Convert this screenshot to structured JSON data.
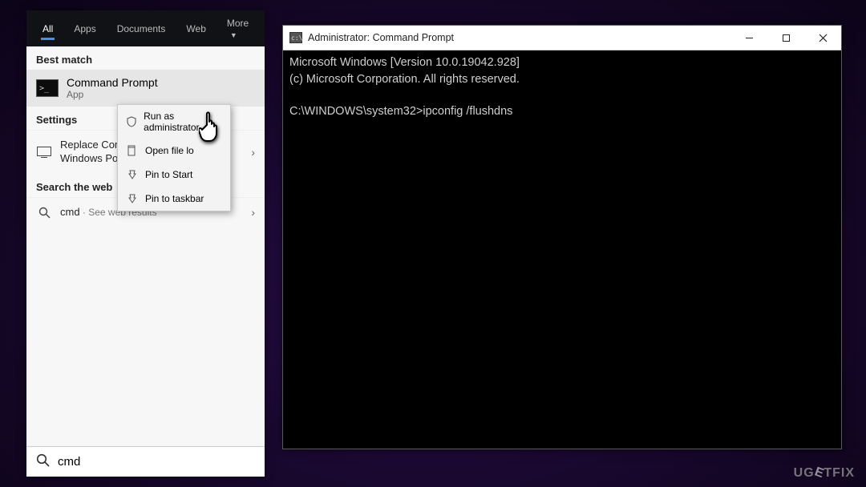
{
  "search": {
    "tabs": {
      "all": "All",
      "apps": "Apps",
      "documents": "Documents",
      "web": "Web",
      "more": "More"
    },
    "sections": {
      "best_match": "Best match",
      "settings": "Settings",
      "search_web": "Search the web"
    },
    "best_match": {
      "title": "Command Prompt",
      "subtitle": "App"
    },
    "settings_item": {
      "line1": "Replace Com",
      "line2": "Windows Pow"
    },
    "web_item": {
      "query": "cmd",
      "suffix": " · See web results"
    },
    "input_value": "cmd"
  },
  "context_menu": {
    "run_admin": "Run as administrator",
    "open_loc": "Open file lo",
    "pin_start": "Pin to Start",
    "pin_taskbar": "Pin to taskbar"
  },
  "cmd_window": {
    "title": "Administrator: Command Prompt",
    "line1": "Microsoft Windows [Version 10.0.19042.928]",
    "line2": "(c) Microsoft Corporation. All rights reserved.",
    "prompt": "C:\\WINDOWS\\system32>",
    "command": "ipconfig /flushdns"
  },
  "watermark": {
    "text_before": "UG",
    "text_e": "E",
    "text_after": "TFIX"
  }
}
